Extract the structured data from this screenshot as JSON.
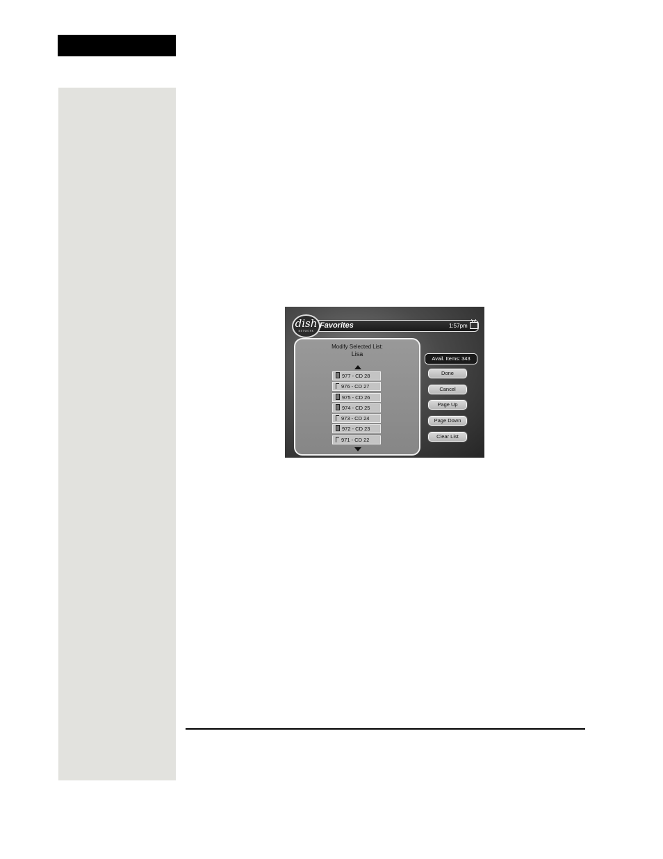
{
  "tv": {
    "logo": "dish",
    "logo_sub": "NETWORK",
    "title": "Favorites",
    "time": "1:57pm",
    "panel": {
      "label": "Modify Selected List:",
      "list_name": "Lisa",
      "items": [
        {
          "label": "977 - CD 28",
          "filled": true
        },
        {
          "label": "976 - CD 27",
          "filled": false
        },
        {
          "label": "975 - CD 26",
          "filled": true
        },
        {
          "label": "974 - CD 25",
          "filled": true
        },
        {
          "label": "973 - CD 24",
          "filled": false
        },
        {
          "label": "972 - CD 23",
          "filled": true
        },
        {
          "label": "971 - CD 22",
          "filled": false
        }
      ]
    },
    "avail_items": "Avail. Items: 343",
    "buttons": {
      "done": "Done",
      "cancel": "Cancel",
      "page_up": "Page Up",
      "page_down": "Page Down",
      "clear_list": "Clear List"
    }
  }
}
